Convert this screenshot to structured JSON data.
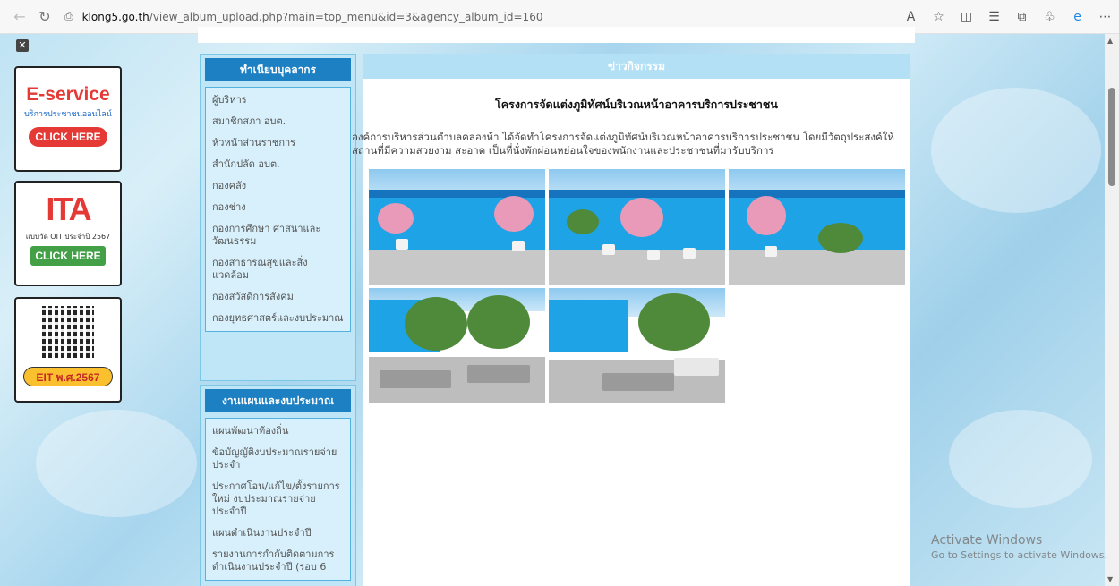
{
  "browser": {
    "url_host": "klong5.go.th",
    "url_path": "/view_album_upload.php?main=top_menu&id=3&agency_album_id=160"
  },
  "banners": {
    "eservice_title": "E-service",
    "eservice_subtitle": "บริการประชาชนออนไลน์",
    "click_here": "CLICK HERE",
    "ita_label": "ITA",
    "ita_subtitle": "แบบวัด OIT ประจำปี 2567",
    "eit_label": "EIT พ.ศ.2567"
  },
  "sidebar": {
    "section1_title": "ทำเนียบบุคลากร",
    "section1_items": [
      "ผู้บริหาร",
      "สมาชิกสภา อบต.",
      "หัวหน้าส่วนราชการ",
      "สำนักปลัด อบต.",
      "กองคลัง",
      "กองช่าง",
      "กองการศึกษา ศาสนาและวัฒนธรรม",
      "กองสาธารณสุขและสิ่งแวดล้อม",
      "กองสวัสดิการสังคม",
      "กองยุทธศาสตร์และงบประมาณ"
    ],
    "section2_title": "งานแผนและงบประมาณ",
    "section2_items": [
      "แผนพัฒนาท้องถิ่น",
      "ข้อบัญญัติงบประมาณรายจ่ายประจำ",
      "ประกาศโอน/แก้ไข/ตั้งรายการใหม่ งบประมาณรายจ่ายประจำปี",
      "แผนดำเนินงานประจำปี",
      "รายงานการกำกับติดตามการดำเนินงานประจำปี (รอบ 6"
    ]
  },
  "main": {
    "header": "ข่าวกิจกรรม",
    "title": "โครงการจัดแต่งภูมิทัศน์บริเวณหน้าอาคารบริการประชาชน",
    "description": "องค์การบริหารส่วนตำบลคลองห้า ได้จัดทำโครงการจัดแต่งภูมิทัศน์บริเวณหน้าอาคารบริการประชาชน โดยมีวัตถุประสงค์ให้สถานที่มีความสวยงาม สะอาด เป็นที่นั่งพักผ่อนหย่อนใจของพนักงานและประชาชนที่มารับบริการ"
  },
  "watermark": {
    "line1": "Activate Windows",
    "line2": "Go to Settings to activate Windows."
  },
  "colors": {
    "side_title_bg": "#1d80c3",
    "main_header_bg": "#b3e0f5",
    "side_bg": "#bfe6f7"
  }
}
